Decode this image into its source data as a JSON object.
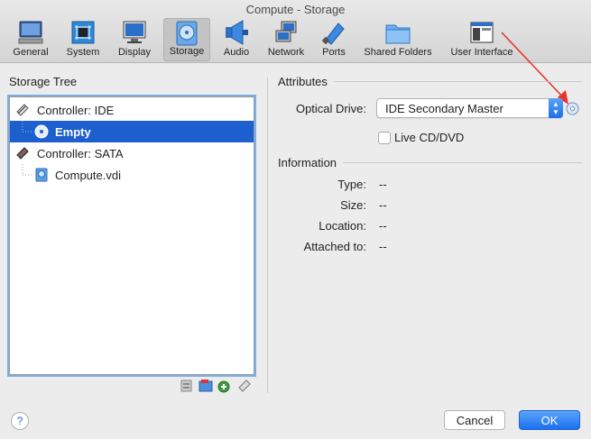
{
  "window": {
    "title": "Compute - Storage"
  },
  "toolbar": {
    "items": [
      {
        "label": "General",
        "icon": "general-icon"
      },
      {
        "label": "System",
        "icon": "system-icon"
      },
      {
        "label": "Display",
        "icon": "display-icon"
      },
      {
        "label": "Storage",
        "icon": "storage-icon",
        "selected": true
      },
      {
        "label": "Audio",
        "icon": "audio-icon"
      },
      {
        "label": "Network",
        "icon": "network-icon"
      },
      {
        "label": "Ports",
        "icon": "ports-icon"
      },
      {
        "label": "Shared Folders",
        "icon": "shared-folders-icon"
      },
      {
        "label": "User Interface",
        "icon": "user-interface-icon"
      }
    ]
  },
  "storage_tree": {
    "heading": "Storage Tree",
    "items": [
      {
        "label": "Controller: IDE",
        "kind": "controller"
      },
      {
        "label": "Empty",
        "kind": "optical",
        "selected": true
      },
      {
        "label": "Controller: SATA",
        "kind": "controller"
      },
      {
        "label": "Compute.vdi",
        "kind": "disk"
      }
    ]
  },
  "attributes": {
    "heading": "Attributes",
    "optical_drive_label": "Optical Drive:",
    "optical_drive_value": "IDE Secondary Master",
    "live_cd_label": "Live CD/DVD",
    "live_cd_checked": false
  },
  "information": {
    "heading": "Information",
    "rows": [
      {
        "label": "Type:",
        "value": "--"
      },
      {
        "label": "Size:",
        "value": "--"
      },
      {
        "label": "Location:",
        "value": "--"
      },
      {
        "label": "Attached to:",
        "value": "--"
      }
    ]
  },
  "buttons": {
    "help": "?",
    "cancel": "Cancel",
    "ok": "OK"
  },
  "colors": {
    "selection": "#1e5fd0",
    "accent": "#1b6ff0",
    "annotation_arrow": "#e8322a"
  }
}
